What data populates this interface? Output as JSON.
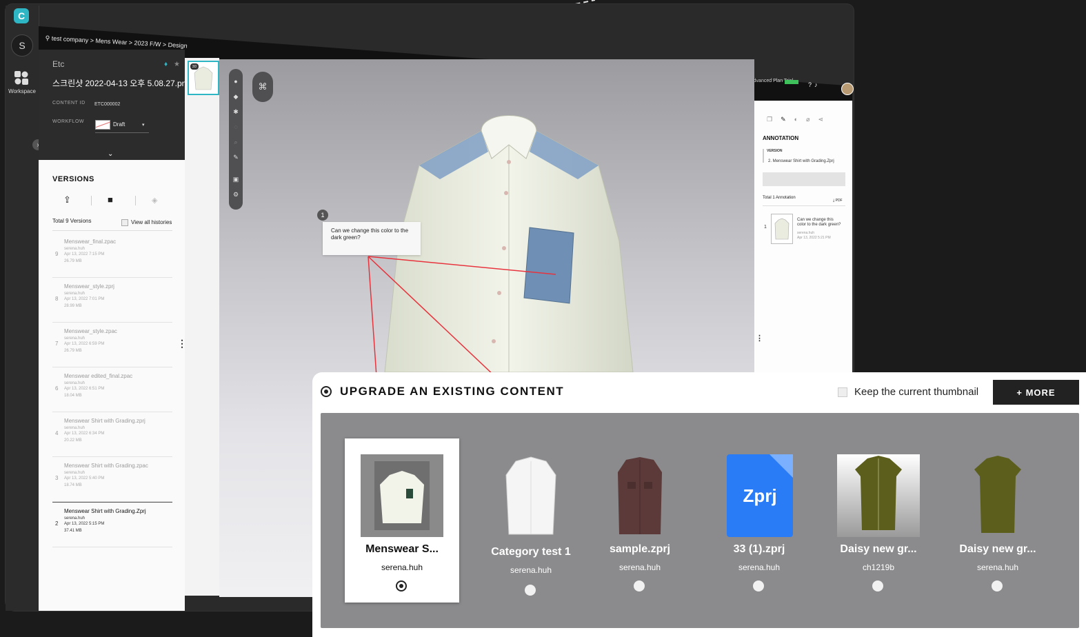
{
  "app": {
    "logo_letter": "C",
    "user_initial": "S",
    "workspace_label": "Workspace",
    "breadcrumb": "test company > Mens Wear > 2023 F/W > Design",
    "plan_label": "Advanced Plan Trial",
    "accent_color": "#2fb6c4"
  },
  "info": {
    "category": "Etc",
    "filename": "스크린샷 2022-04-13 오후 5.08.27.png",
    "content_id_label": "CONTENT ID",
    "content_id": "ETC000002",
    "workflow_label": "WORKFLOW",
    "workflow_value": "Draft"
  },
  "versions": {
    "title": "VERSIONS",
    "total": "Total 9 Versions",
    "view_all": "View all histories",
    "items": [
      {
        "num": "9",
        "name": "Menswear_final.zpac",
        "user": "serena.huh",
        "date": "Apr 13, 2022 7:15 PM",
        "size": "26.79 MB"
      },
      {
        "num": "8",
        "name": "Menswear_style.zprj",
        "user": "serena.huh",
        "date": "Apr 13, 2022 7:01 PM",
        "size": "28.99 MB"
      },
      {
        "num": "7",
        "name": "Menswear_style.zpac",
        "user": "serena.huh",
        "date": "Apr 13, 2022 6:59 PM",
        "size": "26.79 MB"
      },
      {
        "num": "6",
        "name": "Menswear edited_final.zpac",
        "user": "serena.huh",
        "date": "Apr 13, 2022 6:51 PM",
        "size": "18.04 MB"
      },
      {
        "num": "4",
        "name": "Menswear Shirt with Grading.zprj",
        "user": "serena.huh",
        "date": "Apr 13, 2022 6:34 PM",
        "size": "20.22 MB"
      },
      {
        "num": "3",
        "name": "Menswear Shirt with Grading.zpac",
        "user": "serena.huh",
        "date": "Apr 13, 2022 5:40 PM",
        "size": "18.74 MB"
      },
      {
        "num": "2",
        "name": "Menswear Shirt with Grading.Zprj",
        "user": "serena.huh",
        "date": "Apr 13, 2022 5:15 PM",
        "size": "37.41 MB"
      }
    ]
  },
  "viewer": {
    "thumb_badge": "3D",
    "annotation_pin": "1",
    "annotation_note": "Can we change this color to the dark green?"
  },
  "annotation_panel": {
    "title": "ANNOTATION",
    "version_label": "VERSION",
    "version_name": "2. Menswear Shirt with Grading.Zprj",
    "total": "Total 1 Annotation",
    "pdf_label": "PDF",
    "item_num": "1",
    "item_text": "Can we change this color to the dark green?",
    "item_user": "serena.huh",
    "item_date": "Apr 13, 2022 5:21 PM"
  },
  "upgrade": {
    "title": "UPGRADE AN EXISTING CONTENT",
    "keep_thumbnail": "Keep the current thumbnail",
    "more_button": "+ MORE",
    "items": [
      {
        "title": "Menswear S...",
        "owner": "serena.huh",
        "selected": true
      },
      {
        "title": "Category test 1",
        "owner": "serena.huh",
        "selected": false
      },
      {
        "title": "sample.zprj",
        "owner": "serena.huh",
        "selected": false
      },
      {
        "title": "33 (1).zprj",
        "owner": "serena.huh",
        "selected": false,
        "badge": "Zprj"
      },
      {
        "title": "Daisy new gr...",
        "owner": "ch1219b",
        "selected": false
      },
      {
        "title": "Daisy new gr...",
        "owner": "serena.huh",
        "selected": false
      }
    ]
  }
}
